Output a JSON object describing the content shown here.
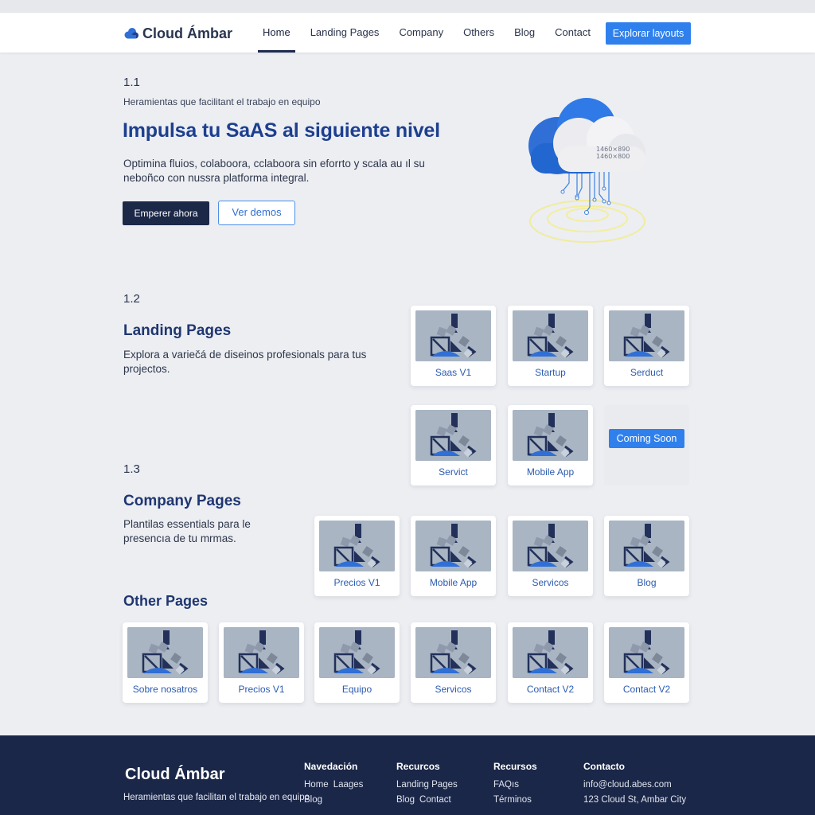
{
  "header": {
    "brand": "Cloud Ámbar",
    "nav": [
      "Home",
      "Landing Pages",
      "Company",
      "Others",
      "Blog",
      "Contact"
    ],
    "active_nav": "Home",
    "cta": "Explorar layouts"
  },
  "hero": {
    "section_number": "1.1",
    "eyebrow": "Heramientas que facilitant el trabajo en equipo",
    "title": "Impulsa tu SaAS al siguiente nivel",
    "description": "Optimina fluios, colaboora, cclaboora sin eforrto y scala au  ıl su neboñco con nussra platforma integral.",
    "primary_button": "Emperer ahora",
    "secondary_button": "Ver demos",
    "illustration_text": [
      "1460×890",
      "1460×800"
    ]
  },
  "landing": {
    "section_number": "1.2",
    "title": "Landing Pages",
    "description": "Explora a variečá de diseinos profesionals para tus projectos.",
    "cards": [
      "Saas V1",
      "Startup",
      "Serduct",
      "Servict",
      "Mobile App"
    ],
    "coming_soon": "Coming Soon"
  },
  "company": {
    "section_number": "1.3",
    "title": "Company Pages",
    "description": "Plantilas essentials para le presencıa de tu mrmas.",
    "cards": [
      "Precios V1",
      "Mobile App",
      "Servicos",
      "Blog"
    ]
  },
  "others": {
    "title": "Other Pages",
    "cards": [
      "Sobre nosatros",
      "Precios V1",
      "Equipo",
      "Servicos",
      "Contact V2",
      "Contact V2"
    ]
  },
  "footer": {
    "brand": "Cloud Ámbar",
    "tagline": "Heramientas que facilitan el trabajo en equipo",
    "columns": [
      {
        "title": "Navedación",
        "rows": [
          [
            "Home",
            "Laages"
          ],
          [
            "Blog"
          ]
        ]
      },
      {
        "title": "Recurcos",
        "rows": [
          [
            "Landing Pages"
          ],
          [
            "Blog",
            "Contact"
          ]
        ]
      },
      {
        "title": "Recursos",
        "rows": [
          [
            "FAQıs"
          ],
          [
            "Términos"
          ]
        ]
      },
      {
        "title": "Contacto",
        "rows": [
          [
            "info@cloud.abes.com"
          ],
          [
            "123 Cloud St, Ambar City"
          ]
        ]
      }
    ]
  },
  "colors": {
    "accent": "#2f80ed",
    "navy": "#1c2848",
    "title_blue": "#1d3f8f",
    "background": "#eceef2"
  }
}
